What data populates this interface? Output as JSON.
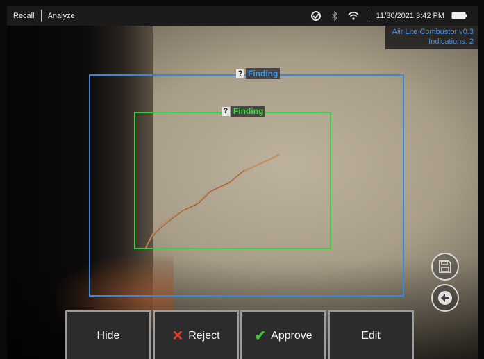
{
  "topbar": {
    "menu": [
      "Recall",
      "Analyze"
    ],
    "icons": [
      "sync-icon",
      "bluetooth-icon",
      "wifi-icon",
      "battery-icon"
    ],
    "datetime": "11/30/2021 3:42 PM"
  },
  "overlay": {
    "profile": "Aiir Lite Combustor v0.3",
    "indications": "Indications: 2"
  },
  "findings": [
    {
      "label": "Finding",
      "marker": "?",
      "color": "#3b86e0"
    },
    {
      "label": "Finding",
      "marker": "?",
      "color": "#3cd03c"
    }
  ],
  "side_buttons": [
    "save-icon",
    "back-arrow-icon"
  ],
  "actions": {
    "hide": "Hide",
    "reject": "Reject",
    "approve": "Approve",
    "edit": "Edit",
    "reject_mark": "✕",
    "approve_mark": "✔",
    "reject_color": "#e63a2e",
    "approve_color": "#42c23a"
  }
}
